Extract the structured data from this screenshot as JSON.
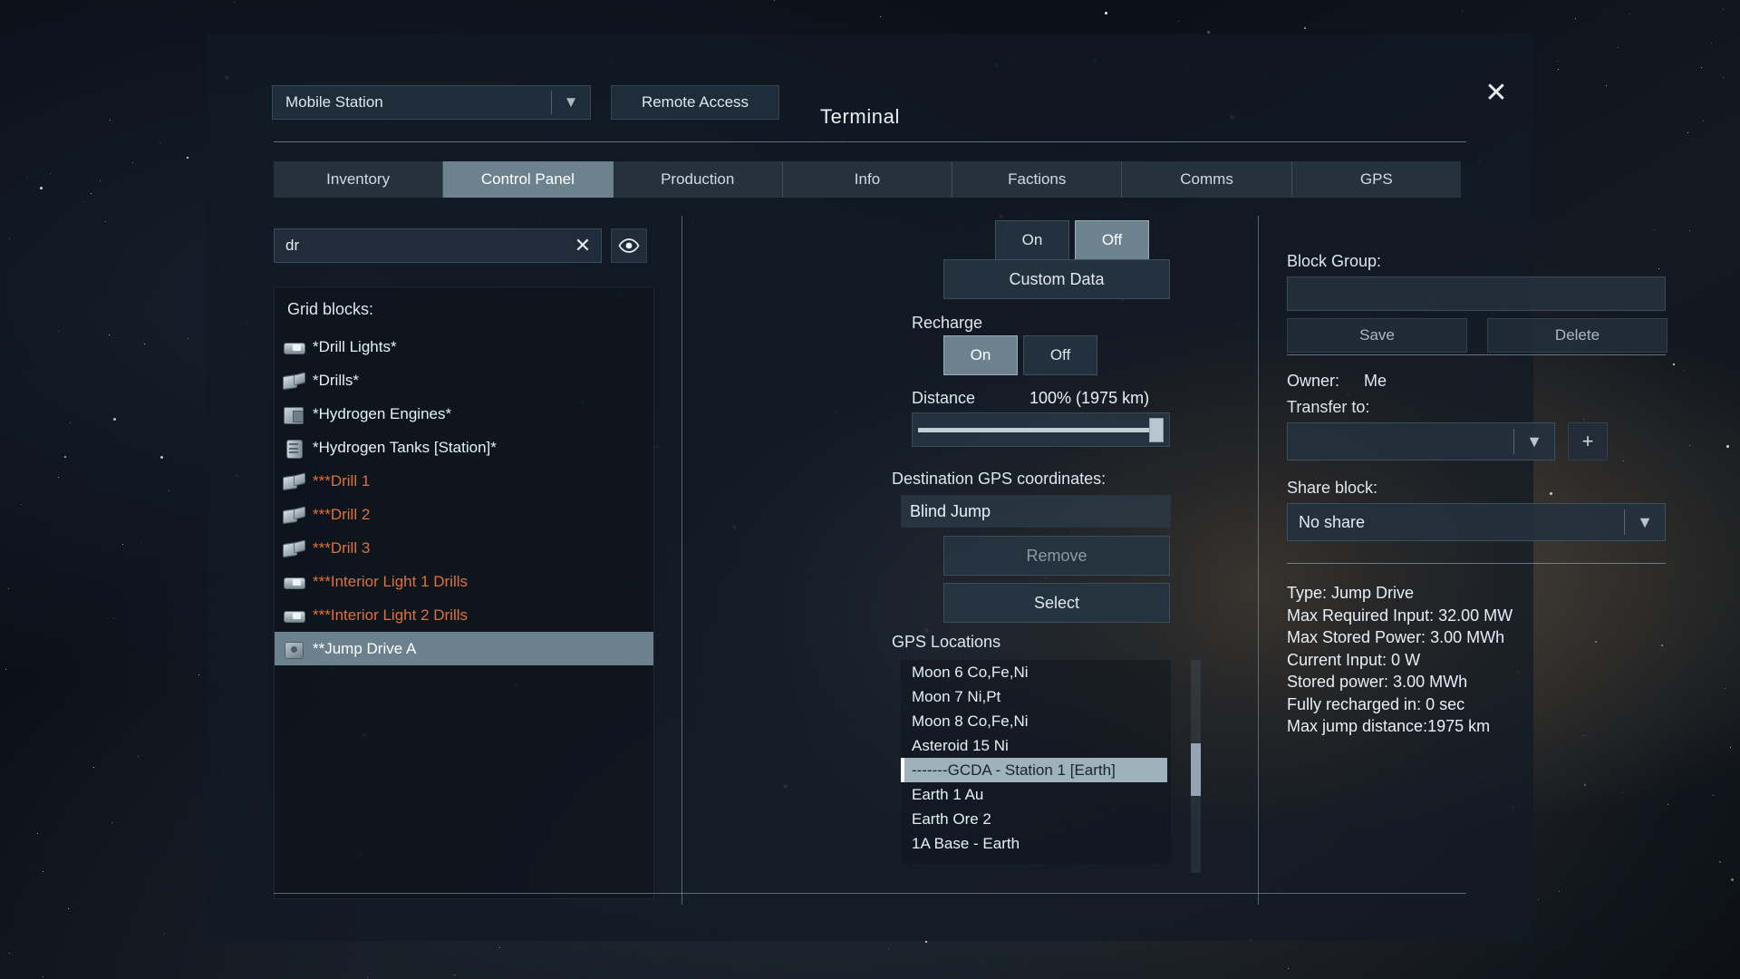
{
  "window": {
    "title": "Terminal",
    "close_icon": "close-icon"
  },
  "header": {
    "grid_name": "Mobile Station",
    "grid_chevron": "chevron-down-icon",
    "remote_access_label": "Remote Access"
  },
  "tabs": [
    {
      "label": "Inventory",
      "active": false
    },
    {
      "label": "Control Panel",
      "active": true
    },
    {
      "label": "Production",
      "active": false
    },
    {
      "label": "Info",
      "active": false
    },
    {
      "label": "Factions",
      "active": false
    },
    {
      "label": "Comms",
      "active": false
    },
    {
      "label": "GPS",
      "active": false
    }
  ],
  "search": {
    "value": "dr",
    "placeholder": "",
    "clear_icon": "close-icon",
    "visibility_icon": "eye-icon"
  },
  "left_panel": {
    "title": "Grid blocks:",
    "items": [
      {
        "name": "*Drill Lights*",
        "icon": "light-block-icon",
        "state": "on",
        "selected": false
      },
      {
        "name": "*Drills*",
        "icon": "drill-block-icon",
        "state": "on",
        "selected": false
      },
      {
        "name": "*Hydrogen Engines*",
        "icon": "engine-block-icon",
        "state": "on",
        "selected": false
      },
      {
        "name": "*Hydrogen Tanks [Station]*",
        "icon": "tank-block-icon",
        "state": "on",
        "selected": false
      },
      {
        "name": "***Drill 1",
        "icon": "drill-block-icon",
        "state": "off",
        "selected": false
      },
      {
        "name": "***Drill 2",
        "icon": "drill-block-icon",
        "state": "off",
        "selected": false
      },
      {
        "name": "***Drill 3",
        "icon": "drill-block-icon",
        "state": "off",
        "selected": false
      },
      {
        "name": "***Interior Light 1 Drills",
        "icon": "light-block-icon",
        "state": "off",
        "selected": false
      },
      {
        "name": "***Interior Light 2 Drills",
        "icon": "light-block-icon",
        "state": "off",
        "selected": false
      },
      {
        "name": "**Jump Drive A",
        "icon": "jump-drive-block-icon",
        "state": "on",
        "selected": true
      }
    ]
  },
  "center_panel": {
    "top_toggle": {
      "on_label": "On",
      "off_label": "Off",
      "selected": "Off"
    },
    "custom_data_label": "Custom Data",
    "recharge_label": "Recharge",
    "recharge_toggle": {
      "on_label": "On",
      "off_label": "Off",
      "selected": "On"
    },
    "distance_label": "Distance",
    "distance_value": "100% (1975 km)",
    "distance_percent": 100,
    "destination_label": "Destination GPS coordinates:",
    "destination_value": "Blind Jump",
    "remove_label": "Remove",
    "select_label": "Select",
    "gps_list_label": "GPS Locations",
    "gps_locations": [
      {
        "name": "Moon 6 Co,Fe,Ni",
        "selected": false
      },
      {
        "name": "Moon 7 Ni,Pt",
        "selected": false
      },
      {
        "name": "Moon 8 Co,Fe,Ni",
        "selected": false
      },
      {
        "name": "Asteroid 15 Ni",
        "selected": false
      },
      {
        "name": "-------GCDA - Station 1 [Earth]",
        "selected": true
      },
      {
        "name": "Earth 1 Au",
        "selected": false
      },
      {
        "name": "Earth Ore 2",
        "selected": false
      },
      {
        "name": "1A Base - Earth",
        "selected": false
      }
    ]
  },
  "right_panel": {
    "block_group_label": "Block Group:",
    "block_group_value": "",
    "save_label": "Save",
    "delete_label": "Delete",
    "owner_label": "Owner:",
    "owner_value": "Me",
    "transfer_label": "Transfer to:",
    "transfer_value": "",
    "transfer_chevron": "chevron-down-icon",
    "add_label": "+",
    "share_label": "Share block:",
    "share_value": "No share",
    "share_chevron": "chevron-down-icon",
    "info_lines": [
      "Type: Jump Drive",
      "Max Required Input: 32.00 MW",
      "Max Stored Power: 3.00 MWh",
      "Current Input: 0 W",
      "Stored power: 3.00 MWh",
      "Fully recharged in: 0 sec",
      "Max jump distance:1975 km"
    ]
  },
  "colors": {
    "accent_selected": "#6c838f",
    "block_off": "#e2703a",
    "text_primary": "#e7eff6",
    "panel_bg": "#131c26"
  }
}
